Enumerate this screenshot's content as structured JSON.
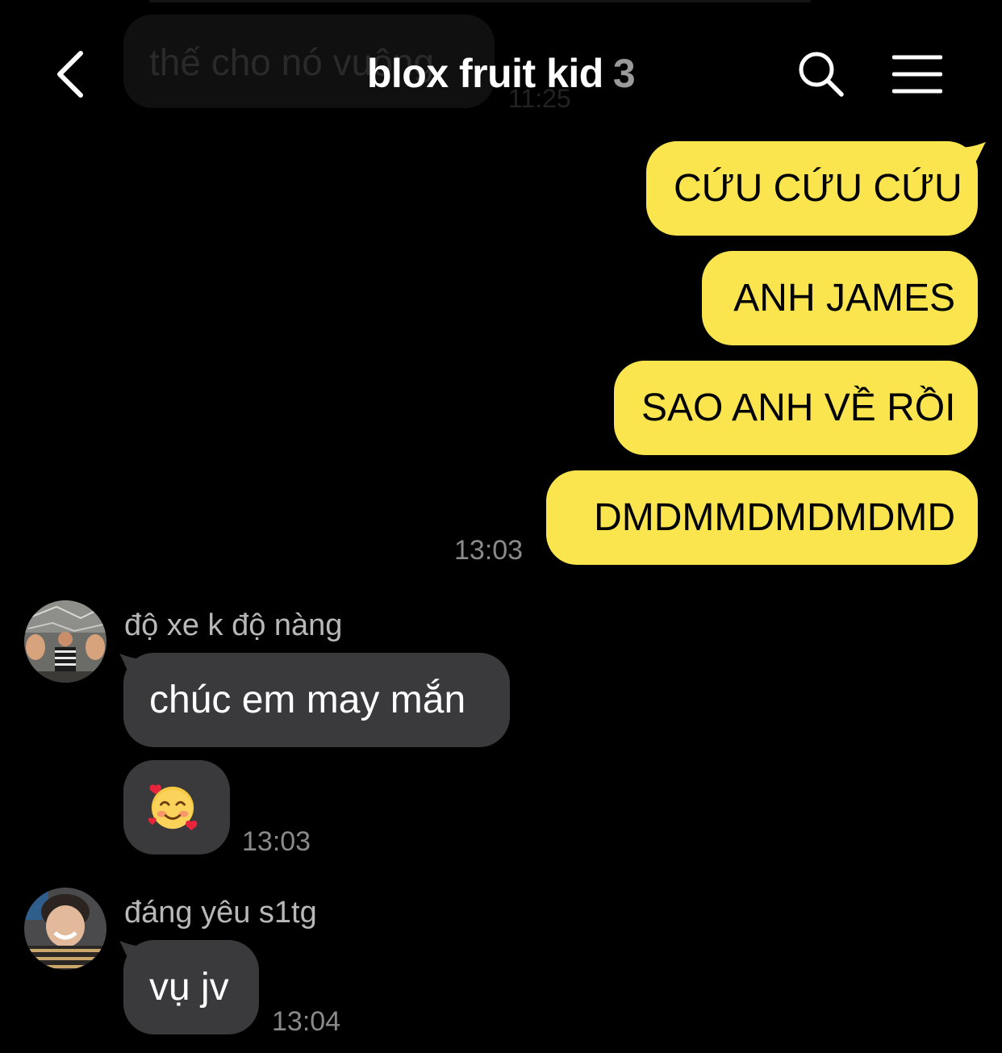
{
  "header": {
    "title": "blox fruit kid",
    "member_count": "3",
    "back_icon": "chevron-left-icon",
    "search_icon": "search-icon",
    "menu_icon": "hamburger-menu-icon"
  },
  "ghost_message": {
    "text": "thế cho nó vuông",
    "time": "11:25"
  },
  "outgoing": {
    "messages": [
      "CỨU CỨU CỨU",
      "ANH JAMES",
      "SAO ANH VỀ RỒI",
      "DMDMMDMDMDMD"
    ],
    "time": "13:03"
  },
  "incoming": [
    {
      "sender": "độ xe k độ nàng",
      "messages": [
        "chúc em may mắn",
        "🥰"
      ],
      "time": "13:03"
    },
    {
      "sender": "đáng yêu s1tg",
      "messages": [
        "vụ jv"
      ],
      "time": "13:04"
    }
  ],
  "colors": {
    "outgoing_bubble": "#fae54e",
    "incoming_bubble": "#3a3a3c",
    "background": "#000000",
    "timestamp": "#8a8a8a"
  }
}
